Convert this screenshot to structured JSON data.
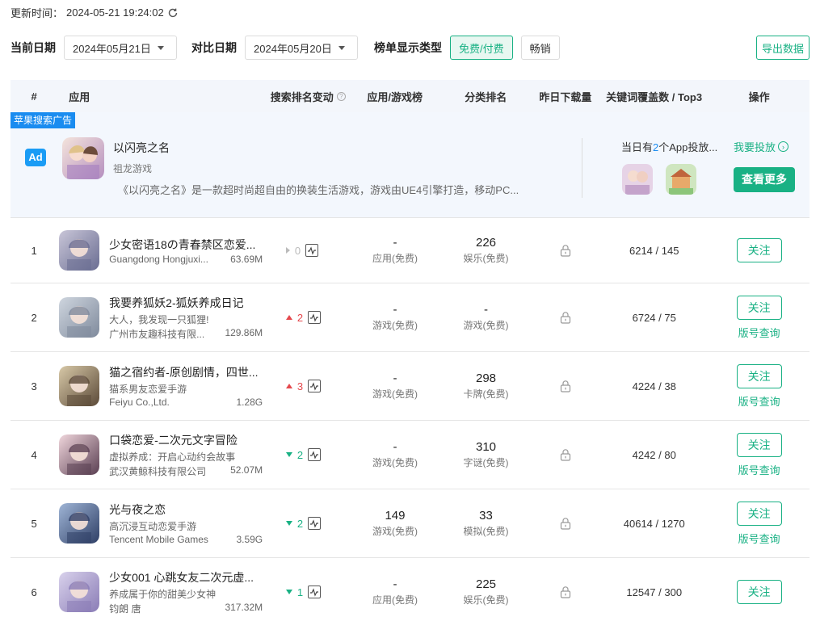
{
  "header": {
    "update_label": "更新时间：",
    "update_time": "2024-05-21 19:24:02"
  },
  "filters": {
    "current_date_label": "当前日期",
    "current_date": "2024年05月21日",
    "compare_date_label": "对比日期",
    "compare_date": "2024年05月20日",
    "list_type_label": "榜单显示类型",
    "type_free_paid": "免费/付费",
    "type_grossing": "畅销",
    "export": "导出数据"
  },
  "columns": {
    "rank": "#",
    "app": "应用",
    "search_change": "搜索排名变动",
    "chart": "应用/游戏榜",
    "category": "分类排名",
    "downloads": "昨日下载量",
    "keywords": "关键词覆盖数 / Top3",
    "ops": "操作"
  },
  "ad": {
    "tag": "苹果搜索广告",
    "badge": "Ad",
    "name": "以闪亮之名",
    "developer": "祖龙游戏",
    "description": "《以闪亮之名》是一款超时尚超自由的换装生活游戏，游戏由UE4引擎打造，移动PC...",
    "count_prefix": "当日有",
    "count_num": "2",
    "count_suffix": "个App投放...",
    "cta": "我要投放",
    "more": "查看更多"
  },
  "ops": {
    "follow": "关注",
    "version_query": "版号查询"
  },
  "rows": [
    {
      "rank": "1",
      "name": "少女密语18の青春禁区恋爱...",
      "subtitle": "",
      "developer": "Guangdong Hongjuxi...",
      "size": "63.69M",
      "dir": "none",
      "change": "0",
      "chart_val": "-",
      "chart_lbl": "应用(免费)",
      "cat_val": "226",
      "cat_lbl": "娱乐(免费)",
      "keywords": "6214 / 145",
      "has_version": false,
      "colors": [
        "#c9c6d8",
        "#6a6d92"
      ]
    },
    {
      "rank": "2",
      "name": "我要养狐妖2-狐妖养成日记",
      "subtitle": "大人，我发现一只狐狸!",
      "developer": "广州市友趣科技有限...",
      "size": "129.86M",
      "dir": "up",
      "change": "2",
      "chart_val": "-",
      "chart_lbl": "游戏(免费)",
      "cat_val": "-",
      "cat_lbl": "游戏(免费)",
      "keywords": "6724 / 75",
      "has_version": true,
      "colors": [
        "#cfd6df",
        "#7f8a9c"
      ]
    },
    {
      "rank": "3",
      "name": "猫之宿约者-原创剧情，四世...",
      "subtitle": "猫系男友恋爱手游",
      "developer": "Feiyu Co.,Ltd.",
      "size": "1.28G",
      "dir": "up",
      "change": "3",
      "chart_val": "-",
      "chart_lbl": "游戏(免费)",
      "cat_val": "298",
      "cat_lbl": "卡牌(免费)",
      "keywords": "4224 / 38",
      "has_version": true,
      "colors": [
        "#d8c9a8",
        "#5b4a38"
      ]
    },
    {
      "rank": "4",
      "name": "口袋恋爱-二次元文字冒险",
      "subtitle": "虚拟养成：开启心动约会故事",
      "developer": "武汉黄鲸科技有限公司",
      "size": "52.07M",
      "dir": "down",
      "change": "2",
      "chart_val": "-",
      "chart_lbl": "游戏(免费)",
      "cat_val": "310",
      "cat_lbl": "字谜(免费)",
      "keywords": "4242 / 80",
      "has_version": true,
      "colors": [
        "#f0d6dc",
        "#5a3f52"
      ]
    },
    {
      "rank": "5",
      "name": "光与夜之恋",
      "subtitle": "高沉浸互动恋爱手游",
      "developer": "Tencent Mobile Games",
      "size": "3.59G",
      "dir": "down",
      "change": "2",
      "chart_val": "149",
      "chart_lbl": "游戏(免费)",
      "cat_val": "33",
      "cat_lbl": "模拟(免费)",
      "keywords": "40614 / 1270",
      "has_version": true,
      "colors": [
        "#9fb5d6",
        "#2f3f66"
      ]
    },
    {
      "rank": "6",
      "name": "少女001 心跳女友二次元虚...",
      "subtitle": "养成属于你的甜美少女神",
      "developer": "钧朗 唐",
      "size": "317.32M",
      "dir": "down",
      "change": "1",
      "chart_val": "-",
      "chart_lbl": "应用(免费)",
      "cat_val": "225",
      "cat_lbl": "娱乐(免费)",
      "keywords": "12547 / 300",
      "has_version": false,
      "colors": [
        "#d9d2ec",
        "#8a7cb6"
      ]
    }
  ],
  "colors": {
    "accent": "#19b184",
    "ad_blue": "#1a8cf0",
    "up": "#e5484d",
    "down": "#19b184"
  }
}
